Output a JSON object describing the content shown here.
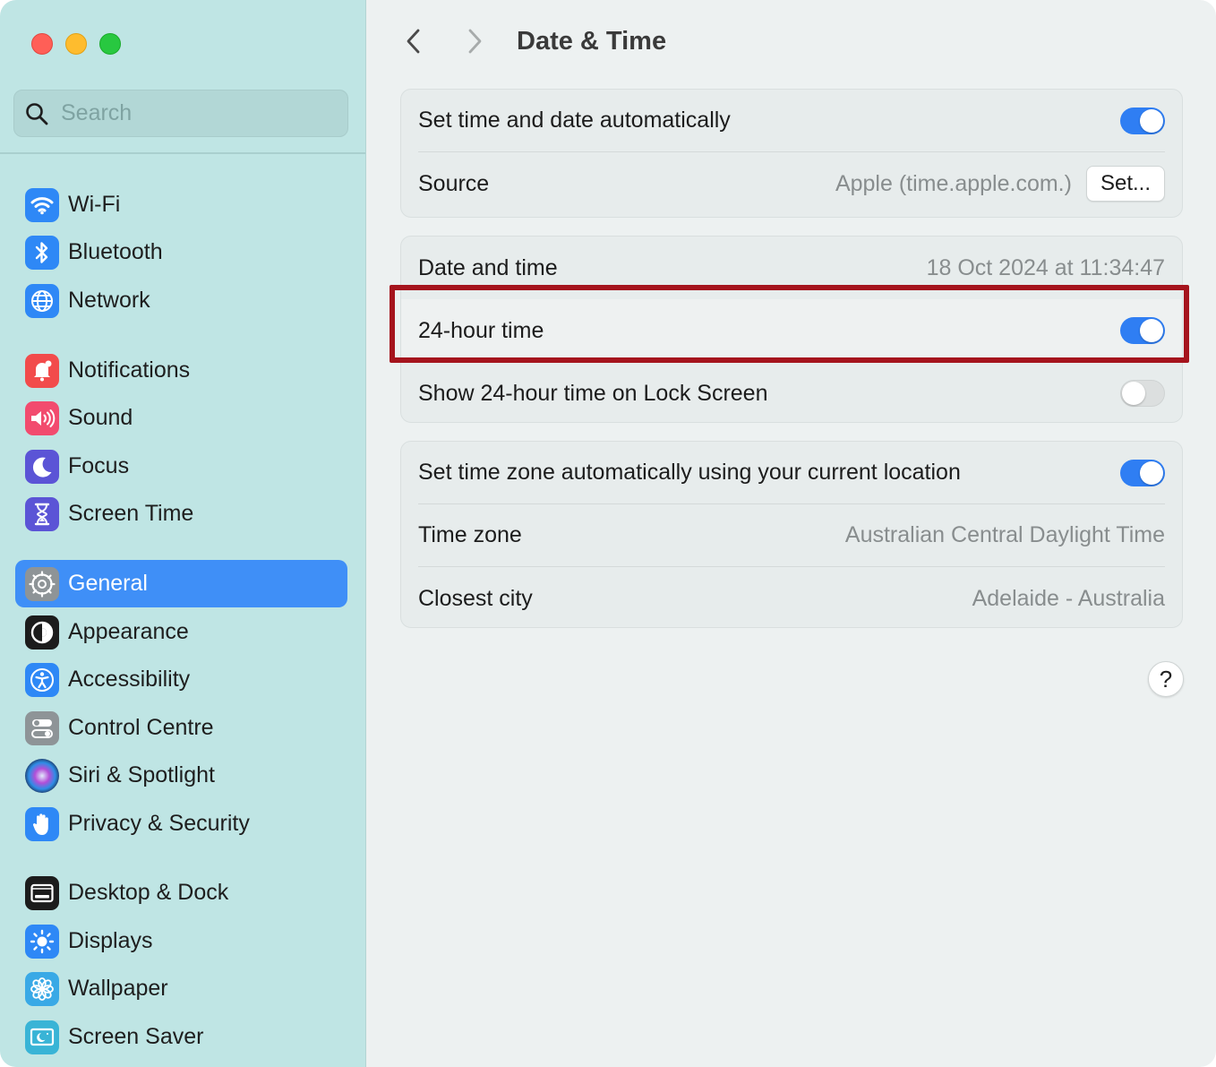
{
  "window": {
    "title": "Date & Time"
  },
  "search": {
    "placeholder": "Search"
  },
  "sidebar": {
    "items": [
      {
        "label": "Wi-Fi",
        "icon": "wifi-icon",
        "color": "#2e88f6"
      },
      {
        "label": "Bluetooth",
        "icon": "bluetooth-icon",
        "color": "#2e88f6"
      },
      {
        "label": "Network",
        "icon": "globe-icon",
        "color": "#2e88f6"
      },
      {
        "label": "Notifications",
        "icon": "bell-icon",
        "color": "#f24b4b"
      },
      {
        "label": "Sound",
        "icon": "speaker-icon",
        "color": "#f24b6e"
      },
      {
        "label": "Focus",
        "icon": "moon-icon",
        "color": "#5b54d6"
      },
      {
        "label": "Screen Time",
        "icon": "hourglass-icon",
        "color": "#5b54d6"
      },
      {
        "label": "General",
        "icon": "gear-icon",
        "color": "#8e9497",
        "active": true
      },
      {
        "label": "Appearance",
        "icon": "appearance-icon",
        "color": "#1c1c1c"
      },
      {
        "label": "Accessibility",
        "icon": "accessibility-icon",
        "color": "#2e88f6"
      },
      {
        "label": "Control Centre",
        "icon": "toggles-icon",
        "color": "#8e9497"
      },
      {
        "label": "Siri & Spotlight",
        "icon": "siri-icon",
        "color": "#3a2a6e"
      },
      {
        "label": "Privacy & Security",
        "icon": "hand-icon",
        "color": "#2e88f6"
      },
      {
        "label": "Desktop & Dock",
        "icon": "dock-icon",
        "color": "#1c1c1c"
      },
      {
        "label": "Displays",
        "icon": "sun-icon",
        "color": "#2e88f6"
      },
      {
        "label": "Wallpaper",
        "icon": "flower-icon",
        "color": "#39a9e6"
      },
      {
        "label": "Screen Saver",
        "icon": "screensaver-icon",
        "color": "#39b4d6"
      }
    ]
  },
  "main": {
    "groups": [
      {
        "rows": [
          {
            "label": "Set time and date automatically",
            "toggle": true
          },
          {
            "label": "Source",
            "value": "Apple (time.apple.com.)",
            "button": "Set..."
          }
        ]
      },
      {
        "rows": [
          {
            "label": "Date and time",
            "value": "18 Oct 2024 at 11:34:47"
          },
          {
            "label": "24-hour time",
            "toggle": true
          },
          {
            "label": "Show 24-hour time on Lock Screen",
            "toggle": false
          }
        ]
      },
      {
        "rows": [
          {
            "label": "Set time zone automatically using your current location",
            "toggle": true
          },
          {
            "label": "Time zone",
            "value": "Australian Central Daylight Time"
          },
          {
            "label": "Closest city",
            "value": "Adelaide - Australia"
          }
        ]
      }
    ],
    "help_label": "?"
  },
  "colors": {
    "accent": "#3f8ff7",
    "toggle_on": "#2f7ef3",
    "highlight_frame": "#a5141d",
    "sidebar_bg": "#bfe5e4"
  }
}
